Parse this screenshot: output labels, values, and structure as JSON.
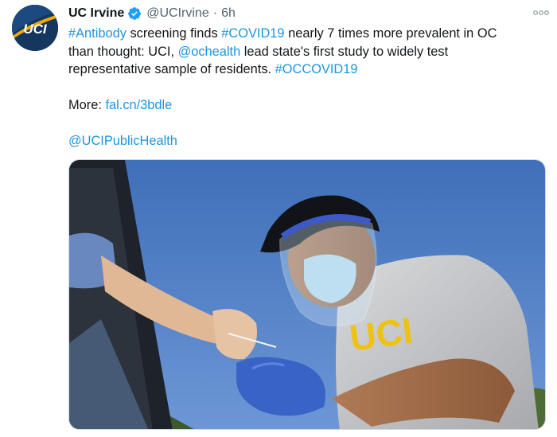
{
  "tweet": {
    "display_name": "UC Irvine",
    "handle": "@UCIrvine",
    "separator": "·",
    "time": "6h",
    "avatar_text": "UCI",
    "line1": {
      "hashtag_antibody": "#Antibody",
      "text_a": " screening finds ",
      "hashtag_covid": "#COVID19",
      "text_b": " nearly 7 times more prevalent in OC"
    },
    "line2": {
      "text_a": "than thought: UCI, ",
      "mention_ochealth": "@ochealth",
      "text_b": " lead state's first study to widely test"
    },
    "line3": {
      "text_a": "representative sample of residents.  ",
      "hashtag_occovid": "#OCCOVID19"
    },
    "more_label": "More: ",
    "link": "fal.cn/3bdle",
    "mention_public_health": "@UCIPublicHealth",
    "media": {
      "shirt_text": "UCI"
    }
  },
  "colors": {
    "link": "#1b95e0",
    "verified": "#1da1f2",
    "secondary": "#536471",
    "avatar_bg": "#14365f",
    "avatar_accent": "#f2a900"
  },
  "icons": {
    "verified": "verified-badge-icon",
    "more": "more-options-icon"
  }
}
